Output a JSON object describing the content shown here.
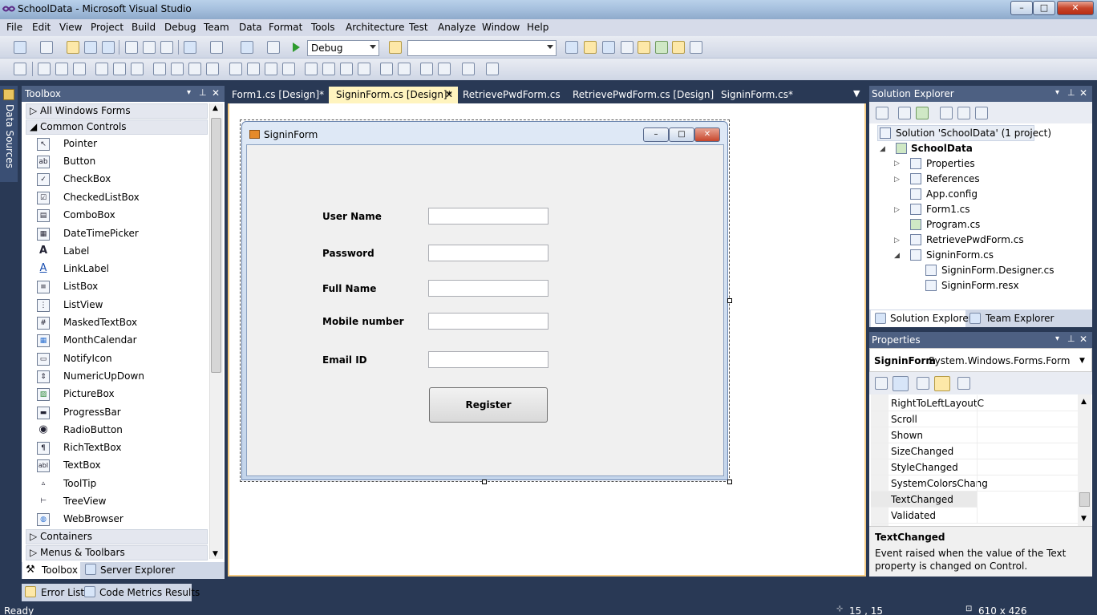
{
  "window": {
    "title": "SchoolData - Microsoft Visual Studio",
    "min": "–",
    "max": "□",
    "close": "✕"
  },
  "menu": [
    "File",
    "Edit",
    "View",
    "Project",
    "Build",
    "Debug",
    "Team",
    "Data",
    "Format",
    "Tools",
    "Architecture",
    "Test",
    "Analyze",
    "Window",
    "Help"
  ],
  "toolbar": {
    "config_value": "Debug",
    "search_value": ""
  },
  "left_strip": {
    "label": "Data Sources"
  },
  "toolbox": {
    "title": "Toolbox",
    "groups": {
      "all": "All Windows Forms",
      "common": "Common Controls",
      "containers": "Containers",
      "menus": "Menus & Toolbars"
    },
    "items": [
      {
        "label": "Pointer",
        "glyph": "↖"
      },
      {
        "label": "Button",
        "glyph": "ab"
      },
      {
        "label": "CheckBox",
        "glyph": "✓"
      },
      {
        "label": "CheckedListBox",
        "glyph": "☑"
      },
      {
        "label": "ComboBox",
        "glyph": "▤"
      },
      {
        "label": "DateTimePicker",
        "glyph": "▦"
      },
      {
        "label": "Label",
        "glyph": "A"
      },
      {
        "label": "LinkLabel",
        "glyph": "A"
      },
      {
        "label": "ListBox",
        "glyph": "≡"
      },
      {
        "label": "ListView",
        "glyph": "⋮"
      },
      {
        "label": "MaskedTextBox",
        "glyph": "#"
      },
      {
        "label": "MonthCalendar",
        "glyph": "▦"
      },
      {
        "label": "NotifyIcon",
        "glyph": "▭"
      },
      {
        "label": "NumericUpDown",
        "glyph": "⇕"
      },
      {
        "label": "PictureBox",
        "glyph": "▨"
      },
      {
        "label": "ProgressBar",
        "glyph": "▬"
      },
      {
        "label": "RadioButton",
        "glyph": "◉"
      },
      {
        "label": "RichTextBox",
        "glyph": "¶"
      },
      {
        "label": "TextBox",
        "glyph": "abl"
      },
      {
        "label": "ToolTip",
        "glyph": "▵"
      },
      {
        "label": "TreeView",
        "glyph": "⊢"
      },
      {
        "label": "WebBrowser",
        "glyph": "◍"
      }
    ],
    "tabs": {
      "toolbox": "Toolbox",
      "server": "Server Explorer"
    }
  },
  "doc_tabs": [
    "Form1.cs [Design]*",
    "SigninForm.cs [Design]*",
    "RetrievePwdForm.cs",
    "RetrievePwdForm.cs [Design]",
    "SigninForm.cs*"
  ],
  "doc_tab_close": "✕",
  "form": {
    "title": "SigninForm",
    "labels": {
      "user": "User Name",
      "password": "Password",
      "fullname": "Full Name",
      "mobile": "Mobile number",
      "email": "Email ID"
    },
    "register": "Register"
  },
  "solution_explorer": {
    "title": "Solution Explorer",
    "solution": "Solution 'SchoolData' (1 project)",
    "project": "SchoolData",
    "items": {
      "properties": "Properties",
      "references": "References",
      "appconfig": "App.config",
      "form1": "Form1.cs",
      "program": "Program.cs",
      "retrieve": "RetrievePwdForm.cs",
      "signin": "SigninForm.cs",
      "designer": "SigninForm.Designer.cs",
      "resx": "SigninForm.resx"
    },
    "tabs": {
      "solution": "Solution Explorer",
      "team": "Team Explorer"
    }
  },
  "properties": {
    "title": "Properties",
    "object_name": "SigninForm",
    "object_type": "System.Windows.Forms.Form",
    "rows": [
      "RightToLeftLayoutC",
      "Scroll",
      "Shown",
      "SizeChanged",
      "StyleChanged",
      "SystemColorsChang",
      "TextChanged",
      "Validated"
    ],
    "selected": "TextChanged",
    "desc_title": "TextChanged",
    "desc_text": "Event raised when the value of the Text property is changed on Control."
  },
  "bottom_tabs": {
    "errors": "Error List",
    "metrics": "Code Metrics Results"
  },
  "status": {
    "left": "Ready",
    "pos": "15 , 15",
    "size": "610 x 426"
  },
  "colors": {
    "chrome": "#293955",
    "panel_header": "#4d6082",
    "active_tab": "#fff4bf"
  }
}
